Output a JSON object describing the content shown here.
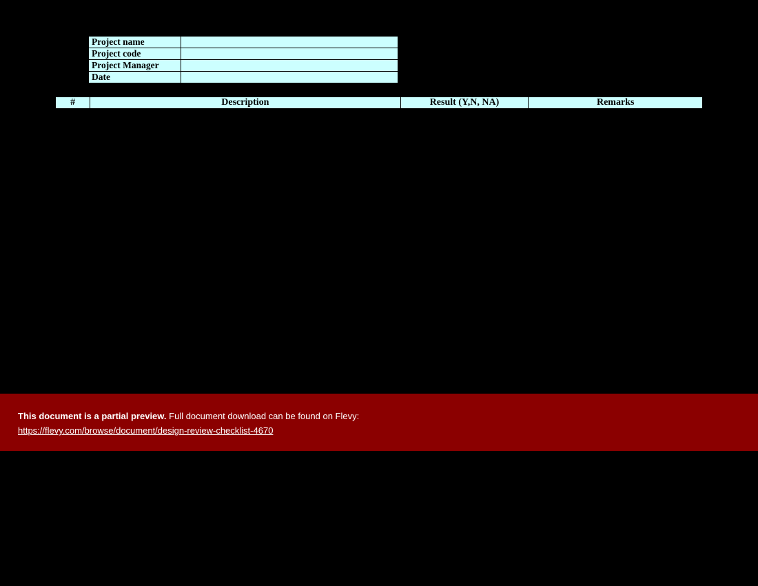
{
  "meta": {
    "rows": [
      {
        "label": "Project name",
        "value": ""
      },
      {
        "label": "Project code",
        "value": ""
      },
      {
        "label": "Project Manager",
        "value": ""
      },
      {
        "label": "Date",
        "value": ""
      }
    ]
  },
  "checklist": {
    "headers": {
      "num": "#",
      "desc": "Description",
      "result": "Result (Y,N, NA)",
      "remarks": "Remarks"
    }
  },
  "banner": {
    "bold": "This document is a partial preview.",
    "rest": "  Full document download can be found on Flevy:",
    "link": "https://flevy.com/browse/document/design-review-checklist-4670"
  }
}
